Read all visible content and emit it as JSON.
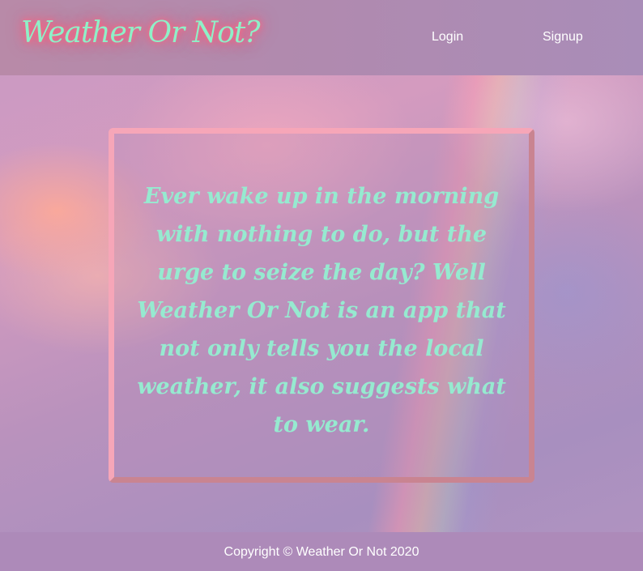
{
  "header": {
    "logo_text": "Weather Or Not?",
    "nav": {
      "login_label": "Login",
      "signup_label": "Signup"
    }
  },
  "hero": {
    "text": "Ever wake up in the morning with nothing to do, but the urge to seize the day? Well Weather Or Not is an app that not only tells you the local weather, it also suggests what to wear."
  },
  "footer": {
    "copyright": "Copyright © Weather Or Not 2020"
  },
  "colors": {
    "logo_text": "#8ef0c8",
    "logo_glow": "#ff5e7a",
    "hero_text": "#96ead0",
    "card_border": "#f6a6b8",
    "header_bg": "#b08aaf",
    "footer_bg": "#ad8ab9"
  }
}
